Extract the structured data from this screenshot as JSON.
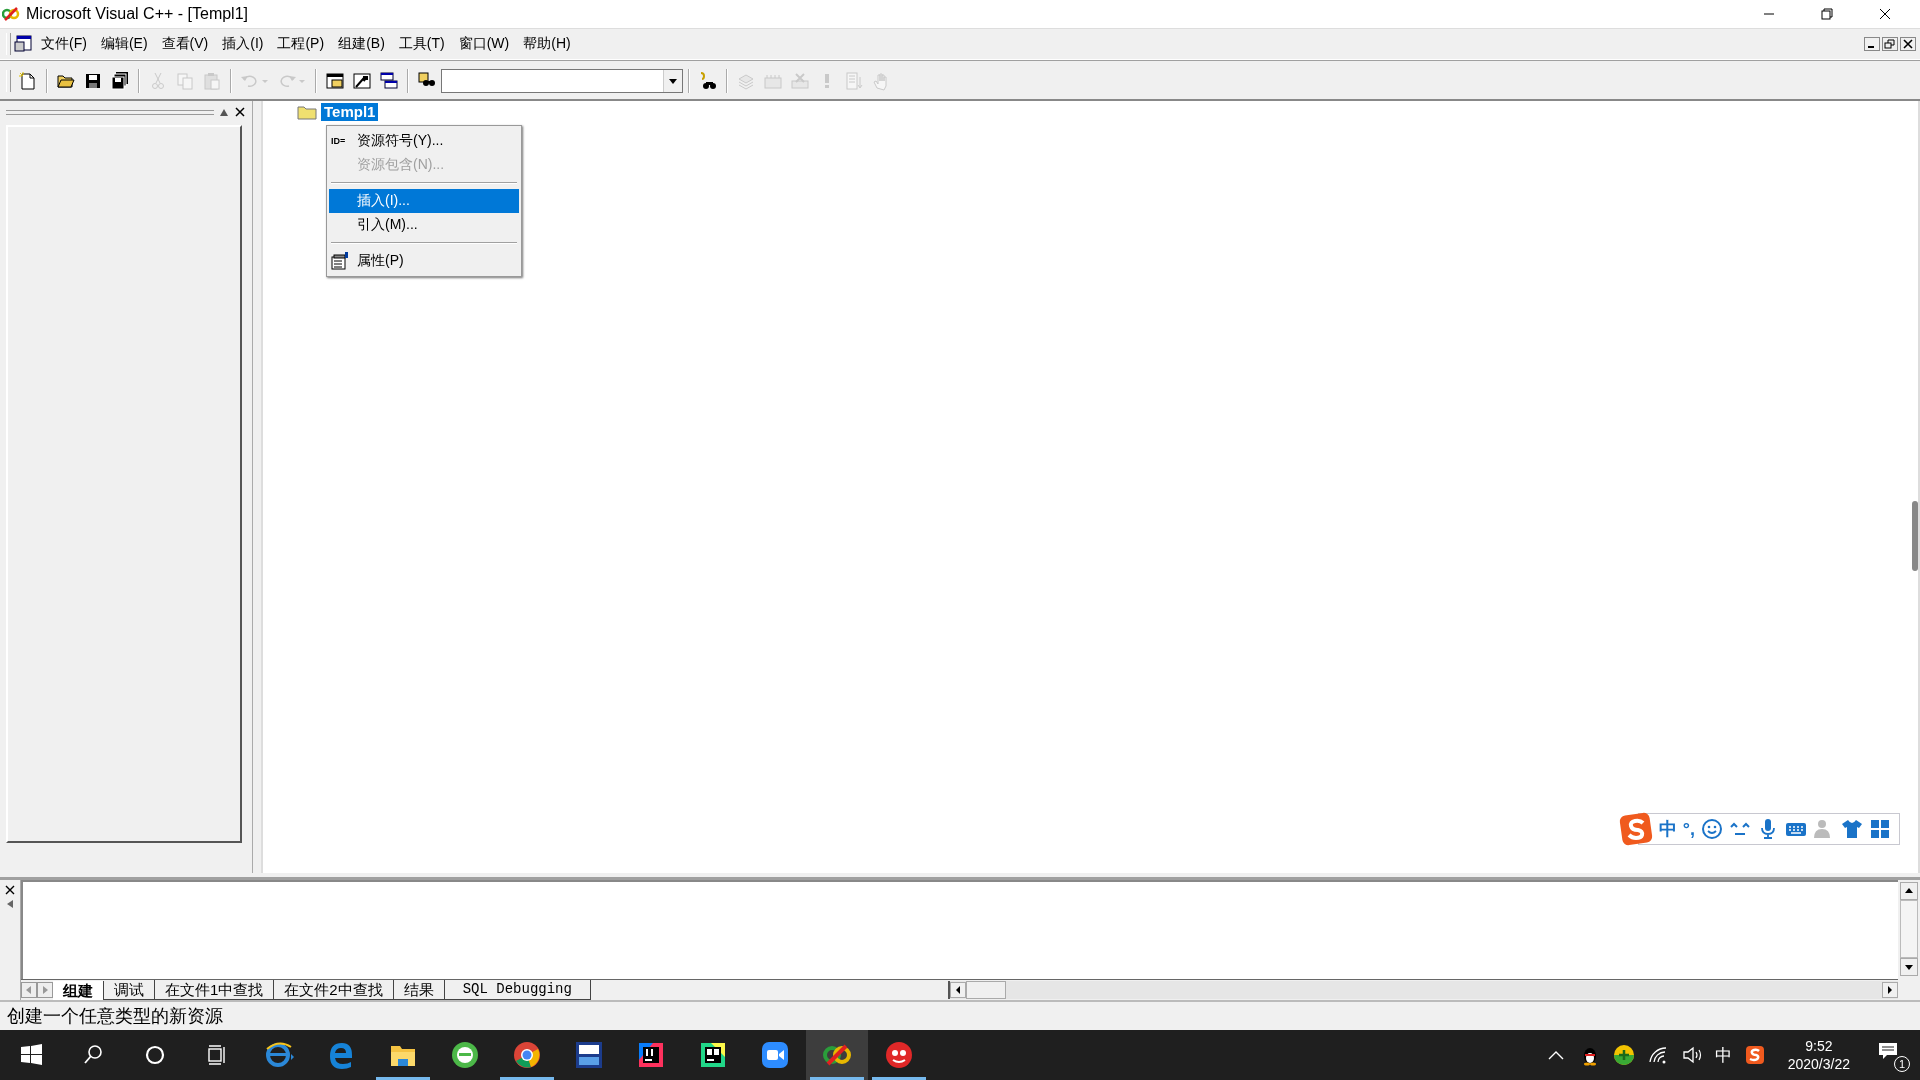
{
  "window": {
    "title": "Microsoft Visual C++ - [Templ1]"
  },
  "menu": [
    {
      "label": "文件(F)"
    },
    {
      "label": "编辑(E)"
    },
    {
      "label": "查看(V)"
    },
    {
      "label": "插入(I)"
    },
    {
      "label": "工程(P)"
    },
    {
      "label": "组建(B)"
    },
    {
      "label": "工具(T)"
    },
    {
      "label": "窗口(W)"
    },
    {
      "label": "帮助(H)"
    }
  ],
  "toolbar": [
    {
      "kind": "new",
      "disabled": false
    },
    {
      "kind": "sep"
    },
    {
      "kind": "open",
      "disabled": false
    },
    {
      "kind": "save",
      "disabled": false
    },
    {
      "kind": "saveall",
      "disabled": false
    },
    {
      "kind": "sep"
    },
    {
      "kind": "cut",
      "disabled": true
    },
    {
      "kind": "copy",
      "disabled": true
    },
    {
      "kind": "paste",
      "disabled": true
    },
    {
      "kind": "sep"
    },
    {
      "kind": "undo",
      "disabled": true
    },
    {
      "kind": "redo",
      "disabled": true
    },
    {
      "kind": "sep"
    },
    {
      "kind": "workspace",
      "disabled": false
    },
    {
      "kind": "output",
      "disabled": false
    },
    {
      "kind": "windows",
      "disabled": false
    },
    {
      "kind": "sep"
    },
    {
      "kind": "find",
      "disabled": false
    },
    {
      "kind": "combo"
    },
    {
      "kind": "sep"
    },
    {
      "kind": "binoculars",
      "disabled": false
    },
    {
      "kind": "sep"
    },
    {
      "kind": "compile",
      "disabled": true
    },
    {
      "kind": "build",
      "disabled": true
    },
    {
      "kind": "stop",
      "disabled": true
    },
    {
      "kind": "execute",
      "disabled": true
    },
    {
      "kind": "insert",
      "disabled": true
    },
    {
      "kind": "hand",
      "disabled": true
    }
  ],
  "tree": [
    {
      "label": "Templ1",
      "selected": true
    }
  ],
  "context_menu": [
    {
      "kind": "item",
      "icon_text": "ID=",
      "label": "资源符号(Y)...",
      "disabled": false,
      "selected": false
    },
    {
      "kind": "item",
      "label": "资源包含(N)...",
      "disabled": true,
      "selected": false
    },
    {
      "kind": "separator"
    },
    {
      "kind": "item",
      "label": "插入(I)...",
      "disabled": false,
      "selected": true
    },
    {
      "kind": "item",
      "label": "引入(M)...",
      "disabled": false,
      "selected": false
    },
    {
      "kind": "separator"
    },
    {
      "kind": "iconitem",
      "label": "属性(P)",
      "disabled": false,
      "selected": false
    }
  ],
  "ime_bar": {
    "mode": "中",
    "punctuation": "°,"
  },
  "output_tabs": [
    {
      "label": "组建",
      "selected": true
    },
    {
      "label": "调试",
      "selected": false
    },
    {
      "label": "在文件1中查找",
      "selected": false
    },
    {
      "label": "在文件2中查找",
      "selected": false
    },
    {
      "label": "结果",
      "selected": false
    },
    {
      "label": "SQL Debugging",
      "selected": false
    }
  ],
  "status_bar": "创建一个任意类型的新资源",
  "taskbar": {
    "apps": [
      {
        "kind": "ie",
        "running": false,
        "active": false
      },
      {
        "kind": "edge",
        "running": false,
        "active": false
      },
      {
        "kind": "explorer",
        "running": true,
        "active": false
      },
      {
        "kind": "browser360",
        "running": false,
        "active": false
      },
      {
        "kind": "chrome",
        "running": true,
        "active": false
      },
      {
        "kind": "devcpp",
        "running": false,
        "active": false
      },
      {
        "kind": "intellij",
        "running": false,
        "active": false
      },
      {
        "kind": "pycharm",
        "running": false,
        "active": false
      },
      {
        "kind": "zoom",
        "running": false,
        "active": false
      },
      {
        "kind": "vcpp",
        "running": true,
        "active": true
      },
      {
        "kind": "redapp",
        "running": true,
        "active": false
      }
    ],
    "input_indicator": "中",
    "time": "9:52",
    "date": "2020/3/22",
    "notification_count": "1"
  }
}
